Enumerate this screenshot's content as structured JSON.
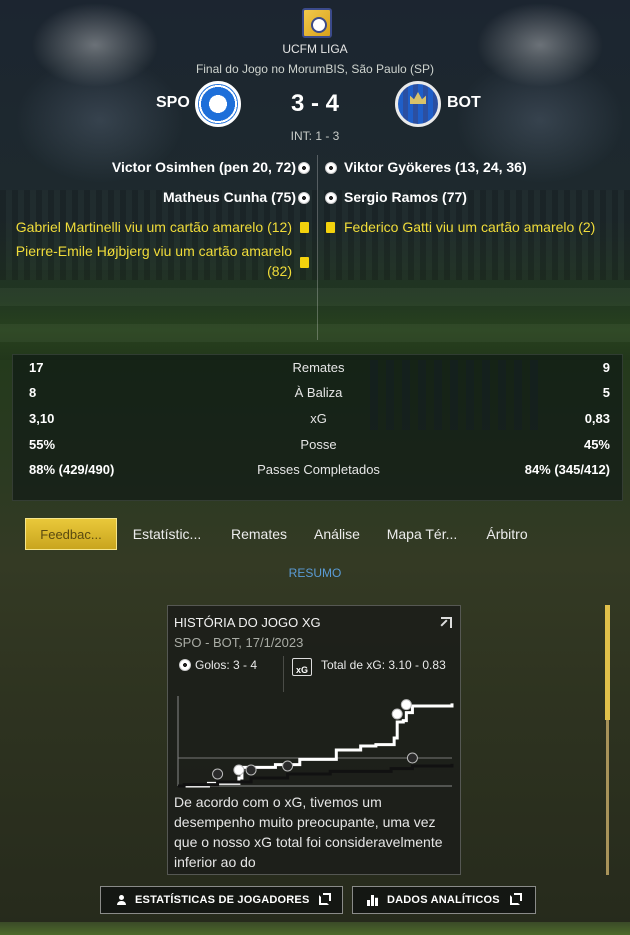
{
  "header": {
    "league": "UCFM LIGA",
    "venue": "Final do Jogo no MorumBIS, São Paulo (SP)",
    "home_team": "SPO",
    "away_team": "BOT",
    "score": "3 - 4",
    "halftime": "INT: 1 - 3"
  },
  "events": {
    "home": [
      {
        "type": "goal",
        "text": "Victor Osimhen (pen 20, 72)"
      },
      {
        "type": "goal",
        "text": "Matheus Cunha (75)"
      },
      {
        "type": "yellow_card",
        "text": "Gabriel Martinelli viu um cartão amarelo (12)"
      },
      {
        "type": "yellow_card",
        "text": "Pierre-Emile Højbjerg viu um cartão amarelo",
        "text2": "(82)"
      }
    ],
    "away": [
      {
        "type": "goal",
        "text": "Viktor Gyökeres (13, 24, 36)"
      },
      {
        "type": "goal",
        "text": "Sergio Ramos (77)"
      },
      {
        "type": "yellow_card",
        "text": "Federico Gatti viu um cartão amarelo (2)"
      }
    ]
  },
  "stats": [
    {
      "label": "Remates",
      "home": "17",
      "away": "9"
    },
    {
      "label": "À Baliza",
      "home": "8",
      "away": "5"
    },
    {
      "label": "xG",
      "home": "3,10",
      "away": "0,83"
    },
    {
      "label": "Posse",
      "home": "55%",
      "away": "45%"
    },
    {
      "label": "Passes Completados",
      "home": "88% (429/490)",
      "away": "84% (345/412)"
    }
  ],
  "tabs": [
    {
      "label": "Feedbac...",
      "active": true
    },
    {
      "label": "Estatístic...",
      "active": false
    },
    {
      "label": "Remates",
      "active": false
    },
    {
      "label": "Análise",
      "active": false
    },
    {
      "label": "Mapa Tér...",
      "active": false
    },
    {
      "label": "Árbitro",
      "active": false
    }
  ],
  "section_label": "RESUMO",
  "xg_card": {
    "title": "HISTÓRIA DO JOGO XG",
    "subtitle": "SPO - BOT, 17/1/2023",
    "goals": "Golos: 3 - 4",
    "xg_icon_text": "xG",
    "total_xg": "Total de xG: 3.10 - 0.83",
    "summary": "De acordo com o xG, tivemos um desempenho muito preocupante, uma vez que o nosso xG total foi consideravelmente inferior ao do"
  },
  "chart_data": {
    "type": "line",
    "xlim": [
      0,
      90
    ],
    "series": [
      {
        "x": [
          0,
          10,
          20,
          21,
          32,
          40,
          52,
          60,
          65,
          71,
          72,
          74,
          75,
          77,
          90
        ],
        "y": [
          0.0,
          0.1,
          0.3,
          0.7,
          0.8,
          1.0,
          1.35,
          1.5,
          1.55,
          1.8,
          2.4,
          2.45,
          2.75,
          3.0,
          3.1
        ]
      },
      {
        "x": [
          0,
          2,
          13,
          24,
          36,
          50,
          70,
          77,
          90
        ],
        "y": [
          0.0,
          0.05,
          0.15,
          0.3,
          0.45,
          0.55,
          0.65,
          0.75,
          0.83
        ]
      }
    ],
    "goals": [
      {
        "minute": 13,
        "team": "BOT"
      },
      {
        "minute": 20,
        "team": "SPO"
      },
      {
        "minute": 24,
        "team": "BOT"
      },
      {
        "minute": 36,
        "team": "BOT"
      },
      {
        "minute": 72,
        "team": "SPO"
      },
      {
        "minute": 75,
        "team": "SPO"
      },
      {
        "minute": 77,
        "team": "BOT"
      }
    ]
  },
  "buttons": {
    "player_stats": "ESTATÍSTICAS DE JOGADORES",
    "analytics": "DADOS ANALÍTICOS"
  },
  "colors": {
    "accent": "#e0c04a",
    "card_yellow": "#f0dc3a",
    "link_blue": "#5b9bd5"
  }
}
